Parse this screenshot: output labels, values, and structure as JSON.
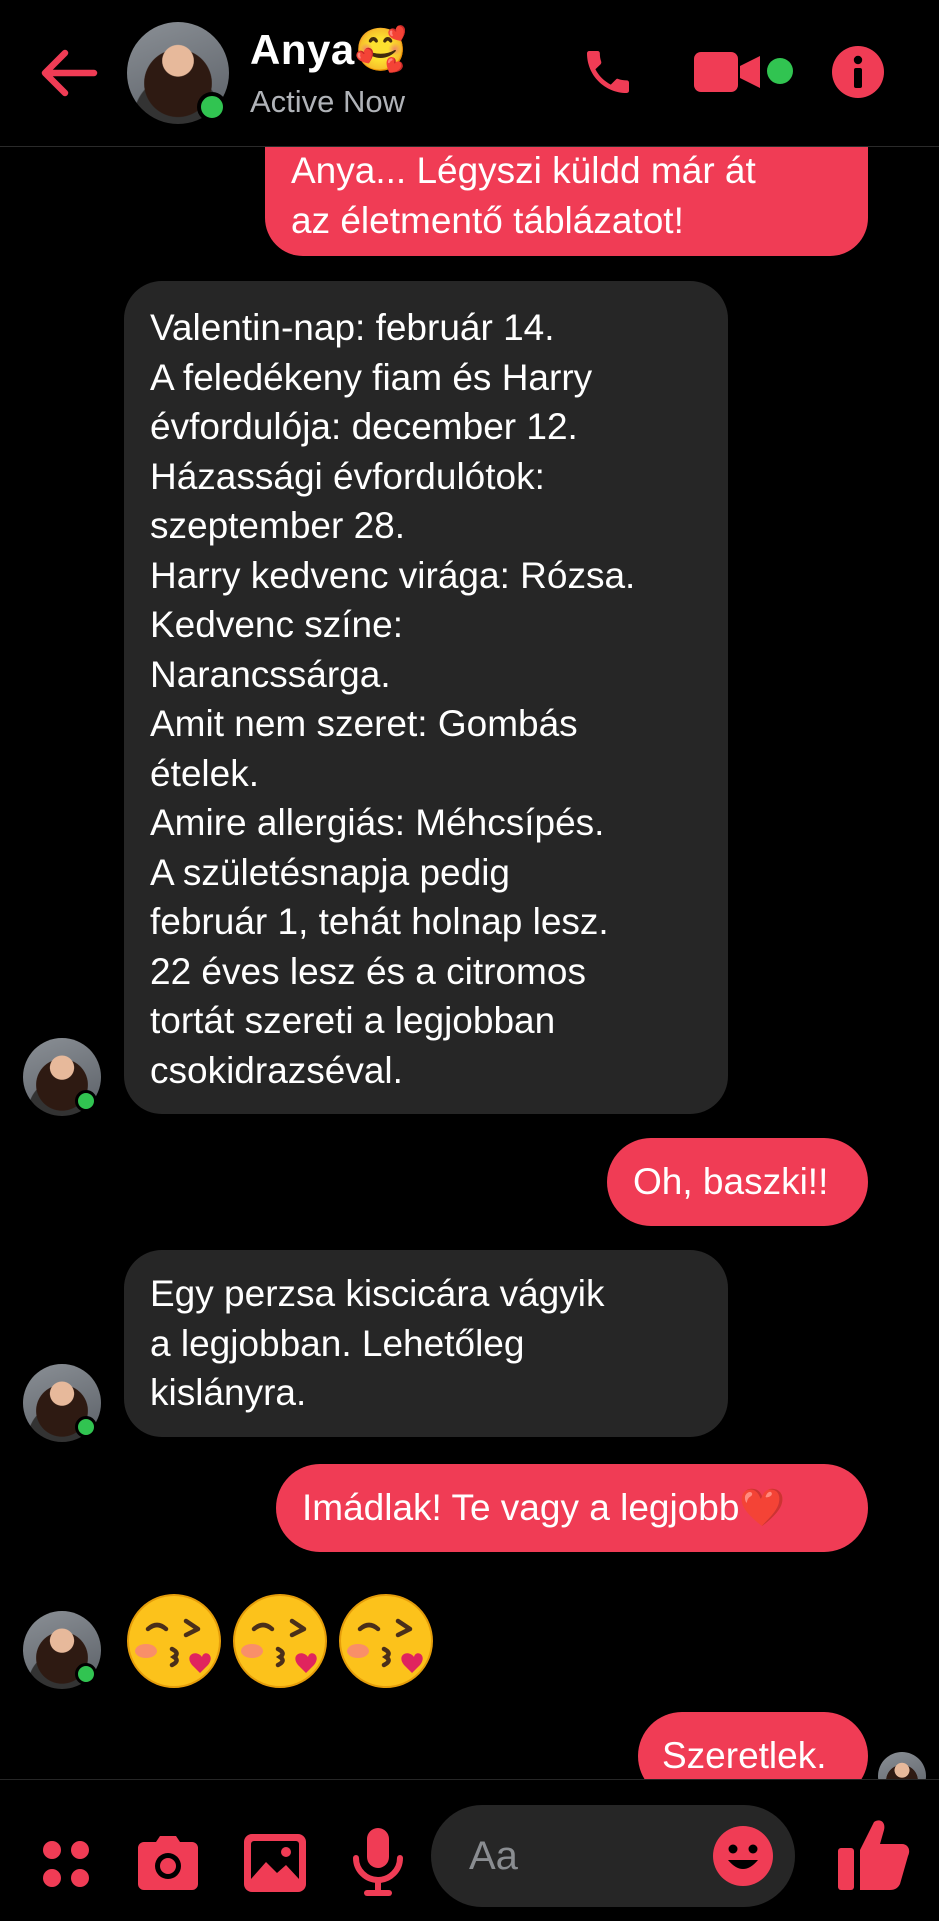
{
  "header": {
    "contact_name": "Anya🥰",
    "status": "Active Now",
    "icons": [
      "back-arrow-icon",
      "phone-icon",
      "video-camera-icon",
      "info-icon"
    ]
  },
  "messages": [
    {
      "direction": "outgoing",
      "text": "Anya... Légyszi küldd már át\naz életmentő táblázatot!"
    },
    {
      "direction": "incoming",
      "text": "Valentin-nap: február 14.\nA feledékeny fiam és Harry\névfordulója: december 12.\nHázassági évfordulótok:\nszeptember 28.\nHarry kedvenc virága: Rózsa.\nKedvenc színe:\nNarancssárga.\nAmit nem szeret: Gombás\nételek.\nAmire allergiás: Méhcsípés.\nA születésnapja pedig\nfebruár 1, tehát holnap lesz.\n22 éves lesz és a citromos\ntortát szereti a legjobban\ncsokidrazséval."
    },
    {
      "direction": "outgoing",
      "text": "Oh, baszki!!"
    },
    {
      "direction": "incoming",
      "text": "Egy perzsa kiscicára vágyik\na legjobban. Lehetőleg\nkislányra."
    },
    {
      "direction": "outgoing",
      "text": "Imádlak! Te vagy a legjobb❤️"
    },
    {
      "direction": "incoming",
      "emojis": [
        "😘",
        "😘",
        "😘"
      ]
    },
    {
      "direction": "outgoing",
      "text": "Szeretlek."
    }
  ],
  "composer": {
    "placeholder": "Aa",
    "icons": [
      "apps-icon",
      "camera-icon",
      "gallery-icon",
      "microphone-icon",
      "emoji-icon",
      "thumbs-up-icon"
    ]
  },
  "colors": {
    "accent": "#f03c55",
    "incoming_bubble": "#262626",
    "online": "#31c451",
    "background": "#000000"
  }
}
